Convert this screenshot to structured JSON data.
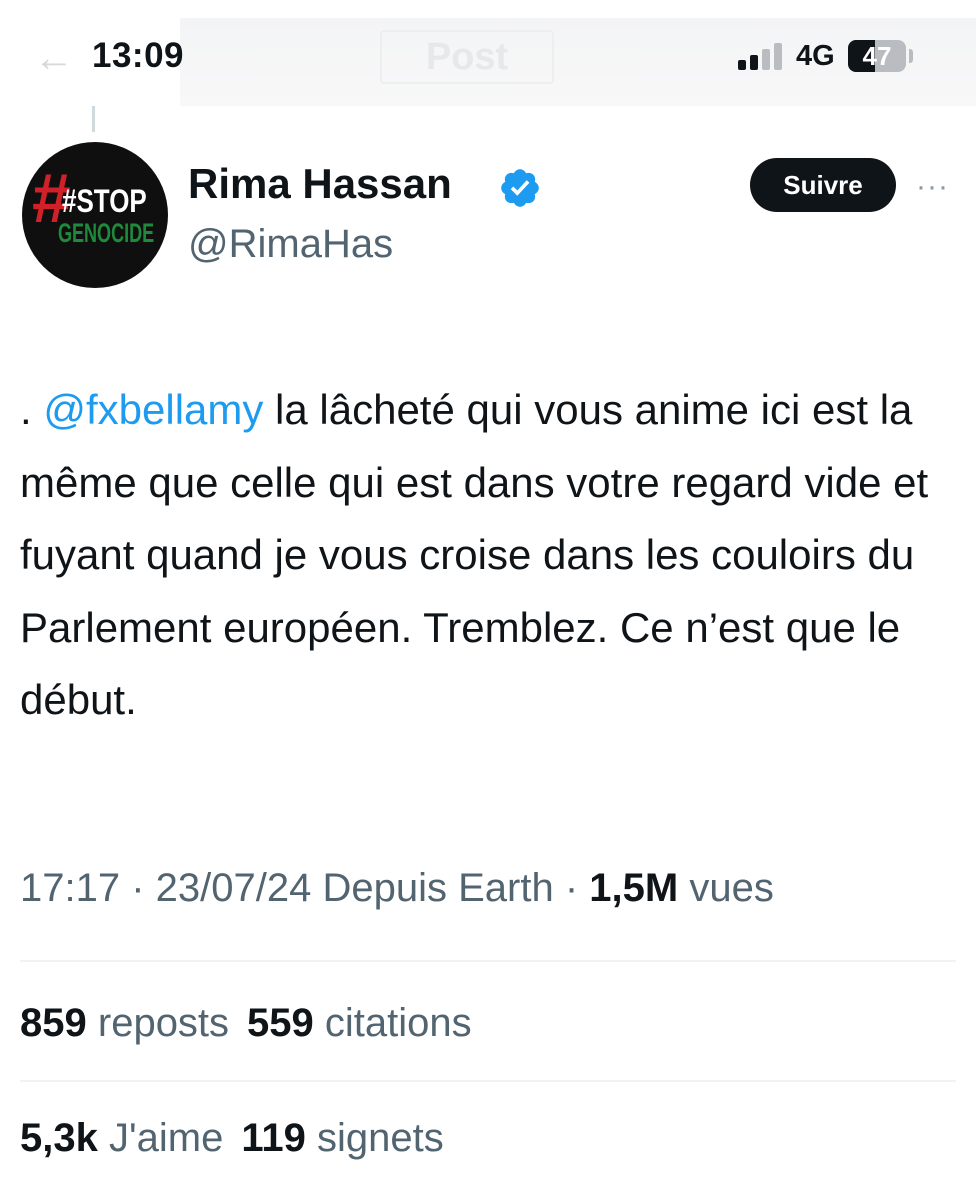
{
  "status_bar": {
    "time": "13:09",
    "network": "4G",
    "battery": "47",
    "battery_level": 0.47
  },
  "header": {
    "title": "Post"
  },
  "author": {
    "display_name": "Rima Hassan",
    "handle": "@RimaHas",
    "verified": true,
    "avatar_text": [
      "#STOP",
      "GENOCIDE"
    ]
  },
  "actions": {
    "follow_label": "Suivre",
    "more_label": "···"
  },
  "tweet": {
    "prefix": ". ",
    "mention": "@fxbellamy",
    "body": " la lâcheté qui vous anime ici est la même que celle qui est dans votre regard vide et fuyant quand je vous croise dans les couloirs du Parlement européen. Tremblez. Ce n’est que le début."
  },
  "meta": {
    "time": "17:17",
    "date": "23/07/24",
    "source": "Depuis Earth",
    "views": "1,5M",
    "views_label": "vues"
  },
  "stats": {
    "reposts": "859",
    "reposts_label": "reposts",
    "quotes": "559",
    "quotes_label": "citations",
    "likes": "5,3k",
    "likes_label": "J'aime",
    "bookmarks": "119",
    "bookmarks_label": "signets"
  },
  "colors": {
    "accent": "#1d9bf0",
    "text": "#0f1419",
    "secondary": "#536471",
    "avatar_red": "#d0202a",
    "avatar_green": "#1f8a3b"
  }
}
